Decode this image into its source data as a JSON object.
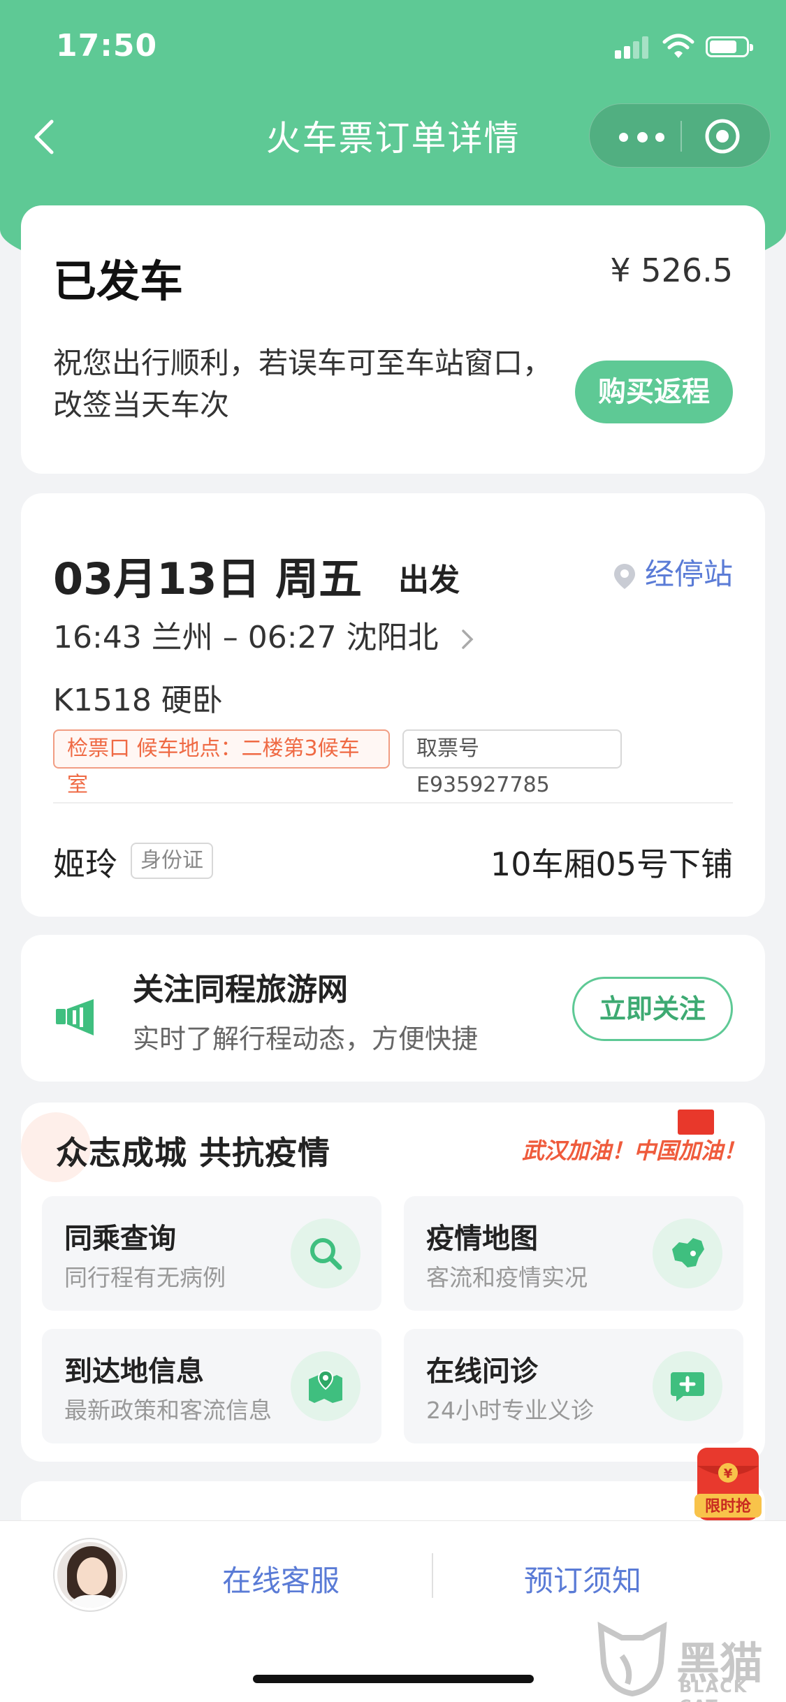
{
  "status_bar": {
    "time": "17:50"
  },
  "nav": {
    "title": "火车票订单详情"
  },
  "order_status": {
    "title": "已发车",
    "price": "¥ 526.5",
    "message": "祝您出行顺利，若误车可至车站窗口，改签当天车次",
    "return_button": "购买返程"
  },
  "trip": {
    "date": "03月13日  周五",
    "depart_label": "出发",
    "stops_link": "经停站",
    "route": "16:43 兰州 – 06:27 沈阳北",
    "train": "K1518   硬卧",
    "gate_tag": "检票口 候车地点：二楼第3候车室",
    "pickup_tag": "取票号 E935927785",
    "passenger_name": "姬玲",
    "id_type": "身份证",
    "seat": "10车厢05号下铺"
  },
  "follow": {
    "title": "关注同程旅游网",
    "subtitle": "实时了解行程动态，方便快捷",
    "button": "立即关注"
  },
  "epidemic": {
    "title": "众志成城 共抗疫情",
    "slogan": "武汉加油！中国加油！",
    "tiles": [
      {
        "title": "同乘查询",
        "subtitle": "同行程有无病例",
        "icon": "search-icon"
      },
      {
        "title": "疫情地图",
        "subtitle": "客流和疫情实况",
        "icon": "china-map-icon"
      },
      {
        "title": "到达地信息",
        "subtitle": "最新政策和客流信息",
        "icon": "map-pin-icon"
      },
      {
        "title": "在线问诊",
        "subtitle": "24小时专业义诊",
        "icon": "chat-plus-icon"
      }
    ]
  },
  "promo": {
    "label": "限时抢"
  },
  "bottom_bar": {
    "service": "在线客服",
    "notice": "预订须知"
  },
  "watermark": {
    "text": "黑猫",
    "sub": "BLACK CAT"
  }
}
